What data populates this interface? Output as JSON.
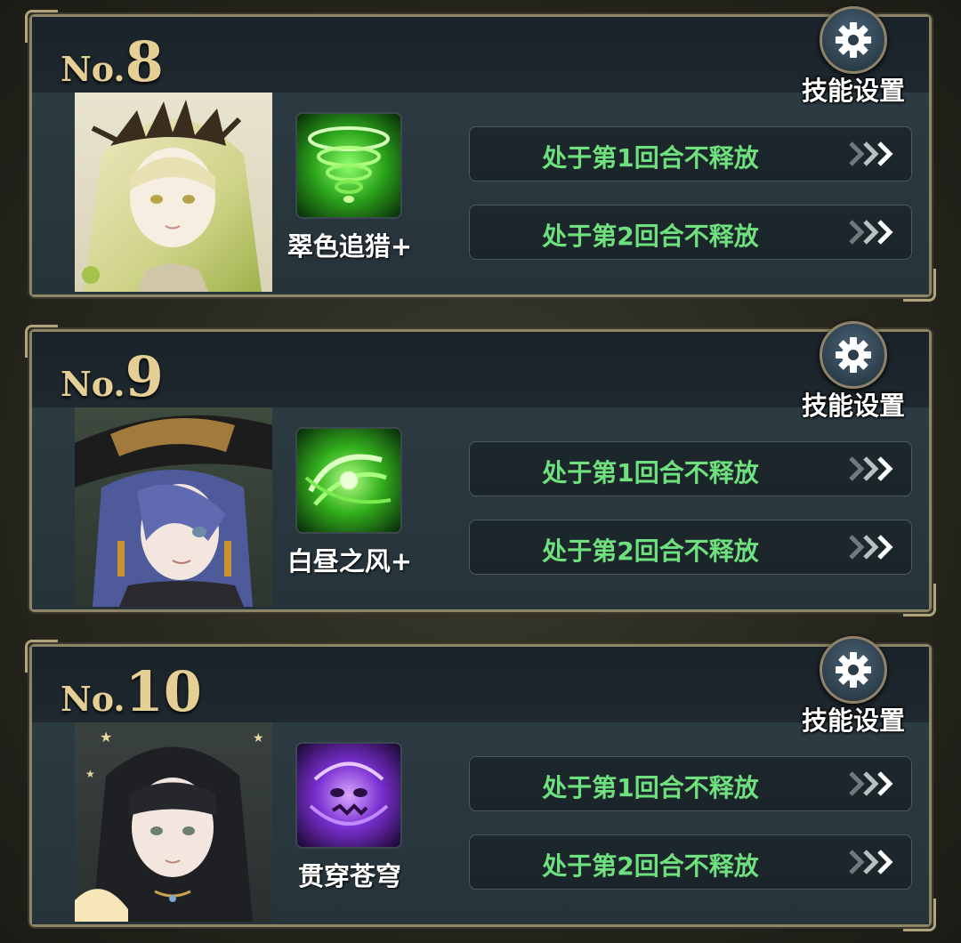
{
  "settings_label": "技能设置",
  "no_prefix": "No.",
  "cards": [
    {
      "number": "8",
      "skill_name": "翠色追猎+",
      "skill_theme": "green-tornado",
      "slots": [
        "处于第1回合不释放",
        "处于第2回合不释放"
      ]
    },
    {
      "number": "9",
      "skill_name": "白昼之风+",
      "skill_theme": "green-swirl",
      "slots": [
        "处于第1回合不释放",
        "处于第2回合不释放"
      ]
    },
    {
      "number": "10",
      "skill_name": "贯穿苍穹",
      "skill_theme": "purple-vortex",
      "slots": [
        "处于第1回合不释放",
        "处于第2回合不释放"
      ]
    }
  ],
  "colors": {
    "slot_text": "#6fe07e",
    "number_gold": "#e6cf95",
    "frame_gold": "#8f8567"
  }
}
